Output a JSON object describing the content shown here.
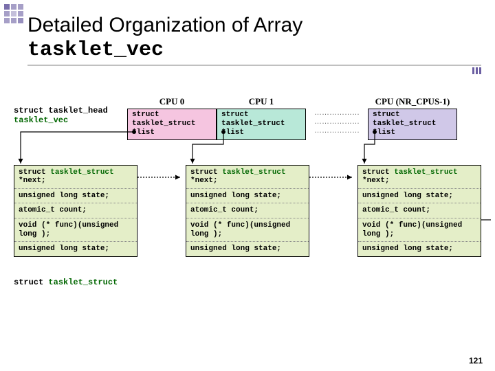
{
  "title": {
    "line1": "Detailed Organization of Array",
    "line2": "tasklet_vec"
  },
  "head_label": {
    "type": "struct tasklet_head",
    "var": "tasklet_vec"
  },
  "cpus": {
    "c0": {
      "label": "CPU 0",
      "text": "struct tasklet_struct *list"
    },
    "c1": {
      "label": "CPU 1",
      "text": "struct tasklet_struct *list"
    },
    "cn": {
      "label": "CPU (NR_CPUS-1)",
      "text": "struct tasklet_struct *list"
    }
  },
  "dots": "………………",
  "struct_rows": {
    "r0": {
      "type": "struct",
      "name": "tasklet_struct",
      "field": "*next;"
    },
    "r1": "unsigned long  state;",
    "r2": "atomic_t count;",
    "r3": "void (* func)(unsigned long );",
    "r4": "unsigned long  state;"
  },
  "foot": {
    "type": "struct",
    "name": "tasklet_struct"
  },
  "page": "121"
}
